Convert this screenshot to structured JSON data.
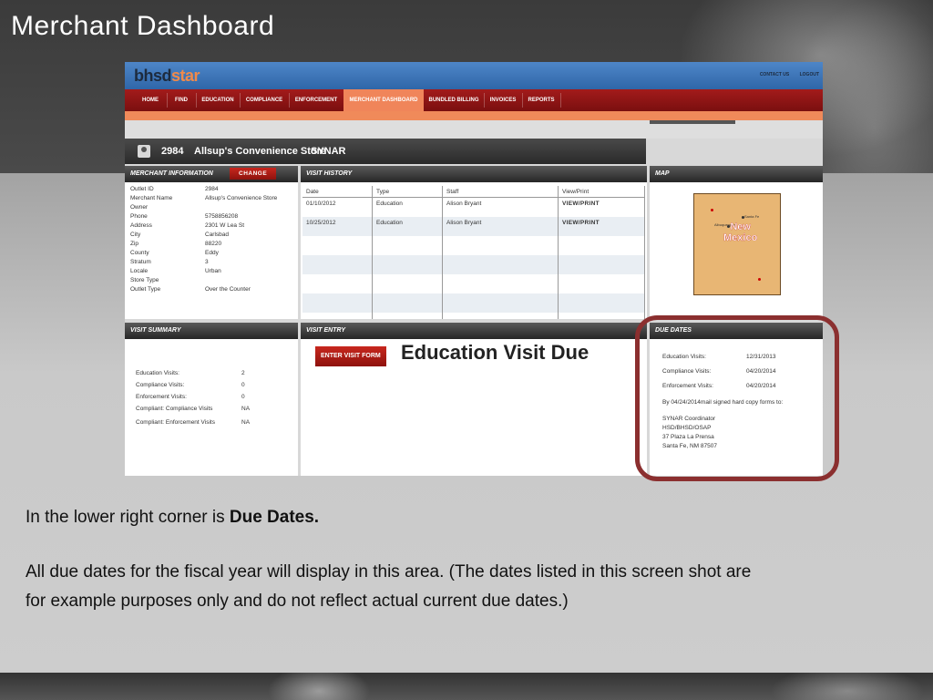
{
  "slide": {
    "title": "Merchant Dashboard",
    "caption_prefix": "In the lower right corner is ",
    "caption_bold": "Due Dates.",
    "body_line1": "All due dates for the fiscal year will display in this area. (The dates listed in this screen shot are",
    "body_line2": "for example purposes only and do not reflect actual current due dates.)"
  },
  "app": {
    "logo_main": "bhsd",
    "logo_accent": "star",
    "top_links": [
      "CONTACT US",
      "LOGOUT"
    ],
    "nav": [
      {
        "label": "HOME",
        "active": false
      },
      {
        "label": "FIND",
        "active": false
      },
      {
        "label": "EDUCATION",
        "active": false
      },
      {
        "label": "COMPLIANCE",
        "active": false
      },
      {
        "label": "ENFORCEMENT",
        "active": false
      },
      {
        "label": "MERCHANT DASHBOARD",
        "active": true
      },
      {
        "label": "BUNDLED BILLING",
        "active": false
      },
      {
        "label": "INVOICES",
        "active": false
      },
      {
        "label": "REPORTS",
        "active": false
      }
    ],
    "merchant_bar": {
      "outlet_id": "2984",
      "store_name": "Allsup's Convenience Store",
      "program": "SYNAR"
    },
    "merchant_info": {
      "title": "MERCHANT INFORMATION",
      "change_label": "CHANGE",
      "fields": [
        {
          "key": "Outlet ID",
          "value": "2984"
        },
        {
          "key": "Merchant Name",
          "value": "Allsup's Convenience Store"
        },
        {
          "key": "Owner",
          "value": ""
        },
        {
          "key": "Phone",
          "value": "5758856208"
        },
        {
          "key": "Address",
          "value": "2301 W Lea St"
        },
        {
          "key": "City",
          "value": "Carlsbad"
        },
        {
          "key": "Zip",
          "value": "88220"
        },
        {
          "key": "County",
          "value": "Eddy"
        },
        {
          "key": "Stratum",
          "value": "3"
        },
        {
          "key": "Locale",
          "value": "Urban"
        },
        {
          "key": "Store Type",
          "value": ""
        },
        {
          "key": "Outlet Type",
          "value": "Over the Counter"
        }
      ]
    },
    "visit_history": {
      "title": "VISIT HISTORY",
      "columns": [
        "Date",
        "Type",
        "Staff",
        "View/Print"
      ],
      "rows": [
        [
          "01/10/2012",
          "Education",
          "Alison Bryant",
          "VIEW/PRINT"
        ],
        [
          "10/25/2012",
          "Education",
          "Alison Bryant",
          "VIEW/PRINT"
        ],
        [
          "",
          "",
          "",
          ""
        ],
        [
          "",
          "",
          "",
          ""
        ],
        [
          "",
          "",
          "",
          ""
        ],
        [
          "",
          "",
          "",
          ""
        ],
        [
          "",
          "",
          "",
          ""
        ]
      ]
    },
    "map": {
      "title": "MAP",
      "state_line1": "New",
      "state_line2": "Mexico",
      "city_label": "Albuquerque",
      "capital_label": "Santa Fe"
    },
    "visit_summary": {
      "title": "VISIT SUMMARY",
      "rows": [
        {
          "key": "Education Visits:",
          "value": "2"
        },
        {
          "key": "Compliance Visits:",
          "value": "0"
        },
        {
          "key": "Enforcement Visits:",
          "value": "0"
        },
        {
          "key": "Compliant: Compliance Visits",
          "value": "NA"
        },
        {
          "key": "Compliant: Enforcement Visits",
          "value": "NA"
        }
      ]
    },
    "visit_entry": {
      "title": "VISIT ENTRY",
      "button_label": "ENTER VISIT FORM",
      "due_message": "Education Visit Due"
    },
    "due_dates": {
      "title": "DUE DATES",
      "rows": [
        {
          "key": "Education Visits:",
          "value": "12/31/2013"
        },
        {
          "key": "Compliance Visits:",
          "value": "04/20/2014"
        },
        {
          "key": "Enforcement Visits:",
          "value": "04/20/2014"
        }
      ],
      "instruction": "By 04/24/2014mail signed hard copy forms to:",
      "address": [
        "SYNAR Coordinator",
        "HSD/BHSD/OSAP",
        "37 Plaza La Prensa",
        "Santa Fe, NM 87507"
      ]
    }
  }
}
